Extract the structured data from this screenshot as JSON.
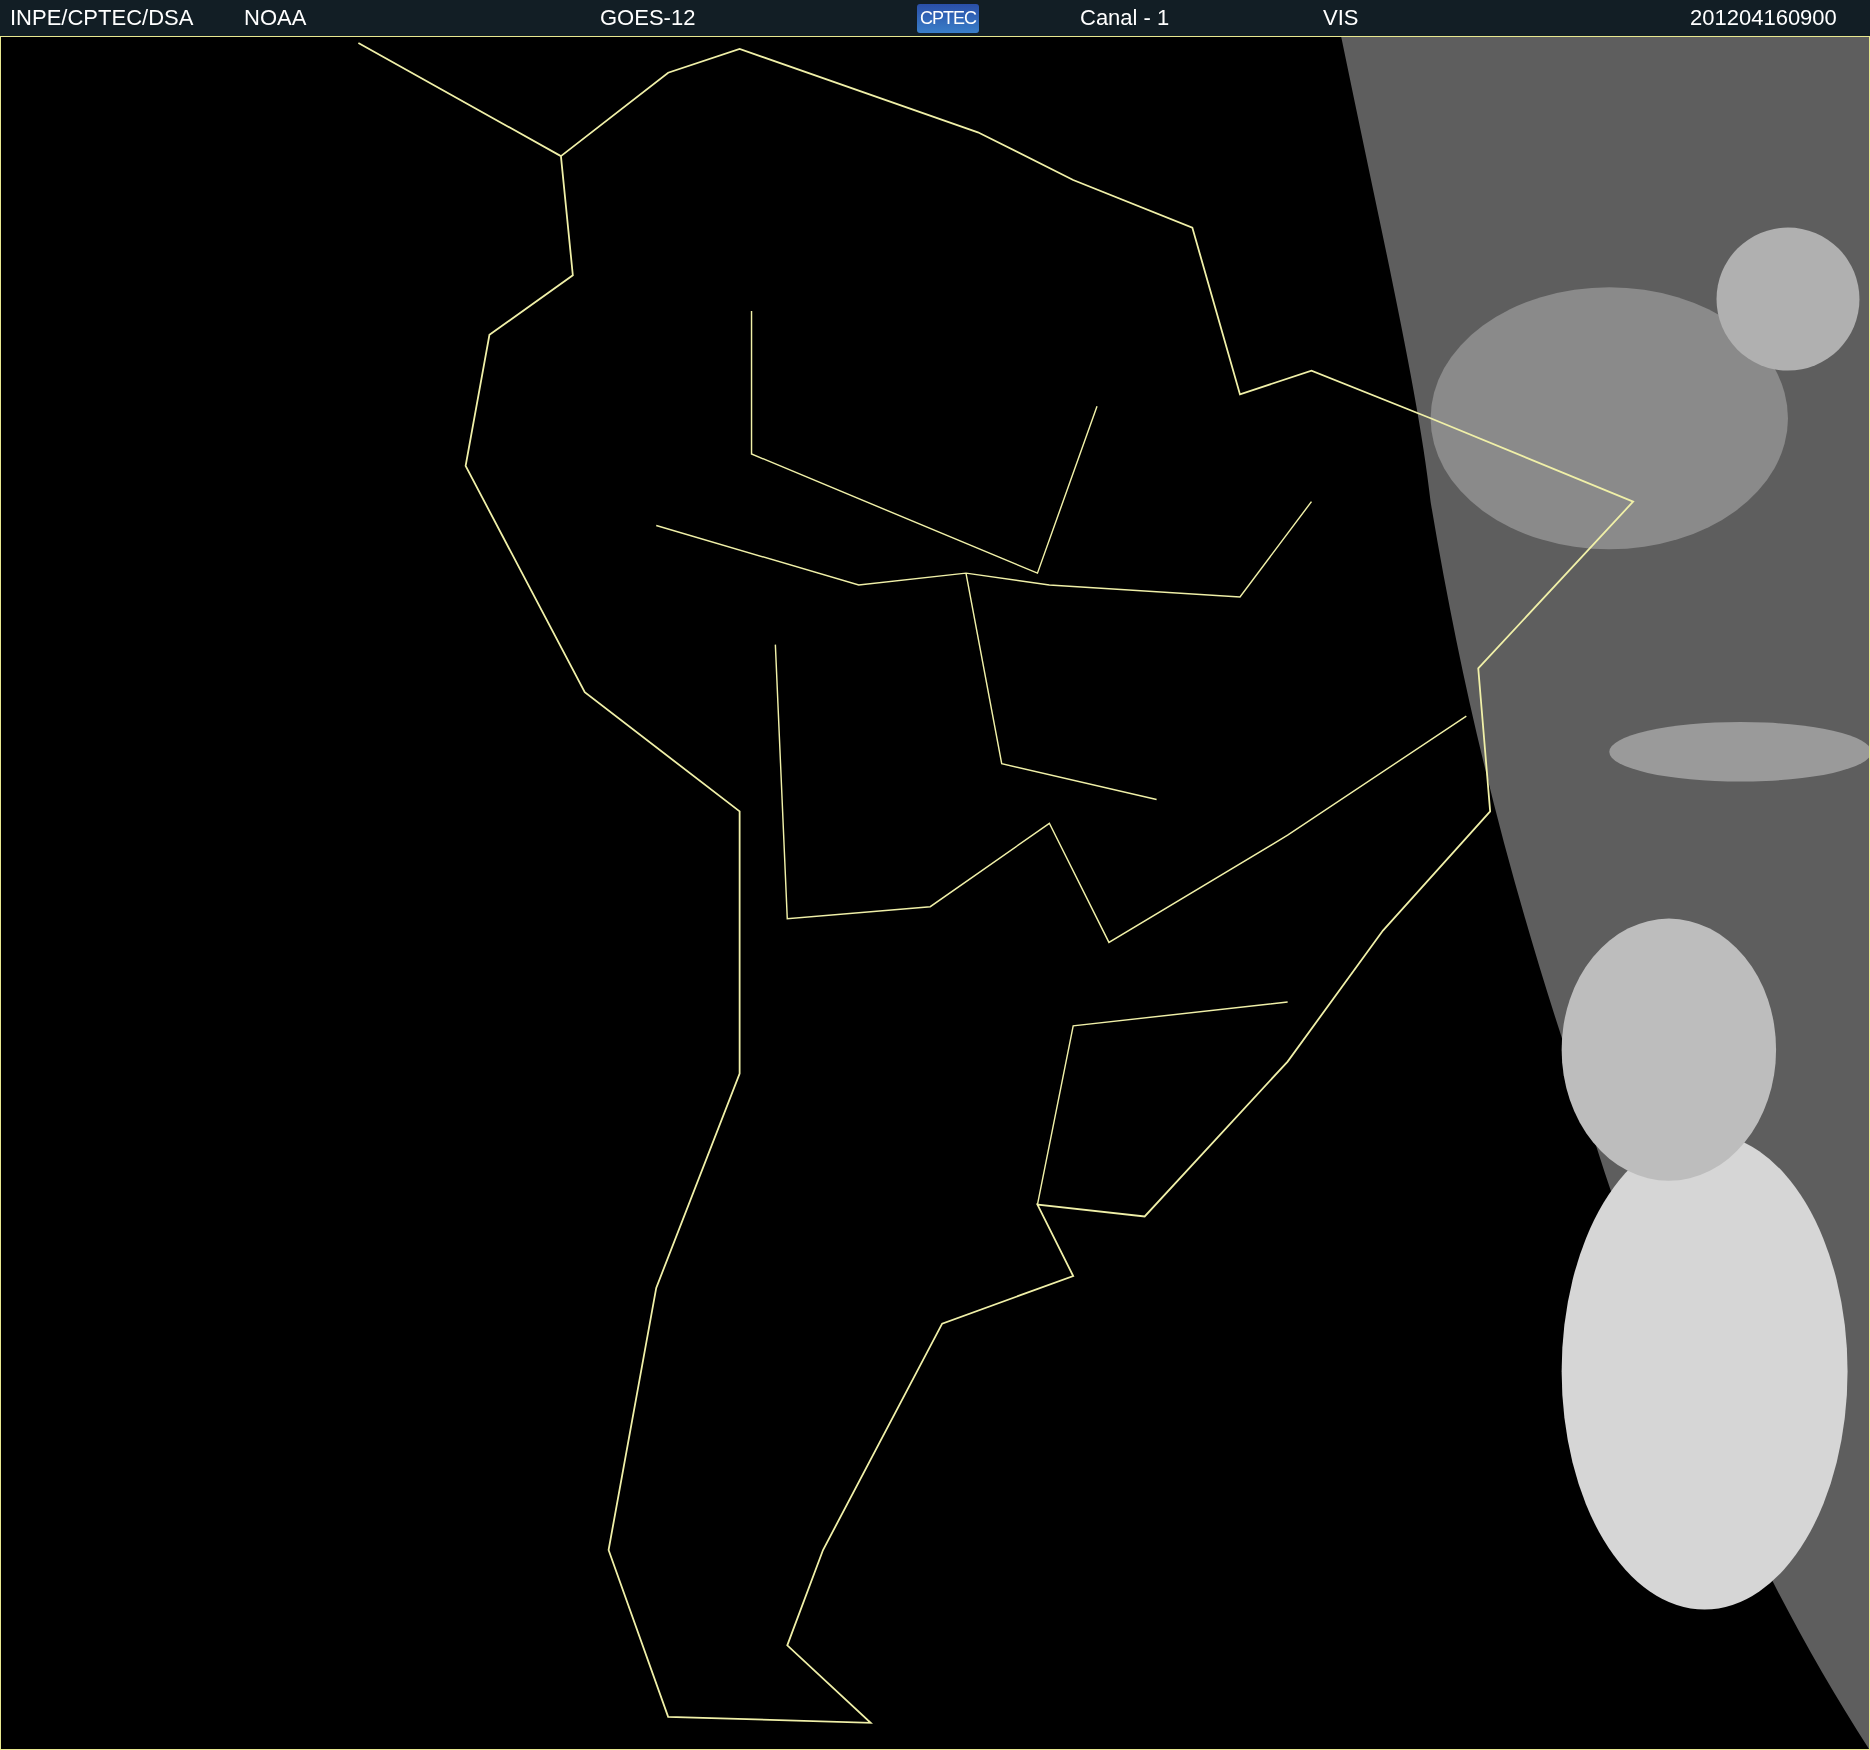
{
  "header": {
    "items": [
      {
        "kind": "text",
        "text": "INPE/CPTEC/DSA"
      },
      {
        "kind": "text",
        "text": "NOAA"
      },
      {
        "kind": "text",
        "text": "GOES-12"
      },
      {
        "kind": "logo",
        "text": "CPTEC"
      },
      {
        "kind": "text",
        "text": "Canal - 1"
      },
      {
        "kind": "text",
        "text": "VIS"
      },
      {
        "kind": "text",
        "text": "201204160900"
      }
    ]
  }
}
